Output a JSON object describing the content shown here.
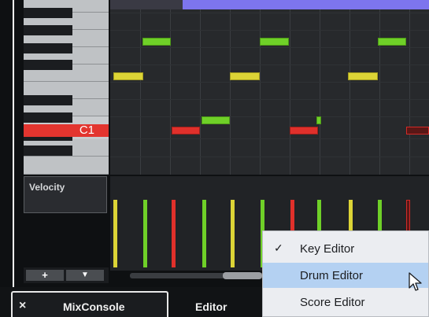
{
  "keyboard": {
    "highlighted_key_label": "C1"
  },
  "velocity_lane": {
    "label": "Velocity"
  },
  "lane_controls": {
    "add_label": "+",
    "menu_label": "▼"
  },
  "tabs": [
    {
      "label": "MixConsole",
      "close_icon": "×"
    },
    {
      "label": "Editor"
    }
  ],
  "context_menu": {
    "items": [
      {
        "label": "Key Editor",
        "checked": true,
        "check_glyph": "✓"
      },
      {
        "label": "Drum Editor",
        "highlighted": true
      },
      {
        "label": "Score Editor"
      }
    ]
  },
  "colors": {
    "note_green": "#6fd028",
    "note_yellow": "#dcd436",
    "note_red": "#e0302b",
    "accent_purple": "#7d75ee",
    "menu_highlight": "#b4d1f2"
  }
}
